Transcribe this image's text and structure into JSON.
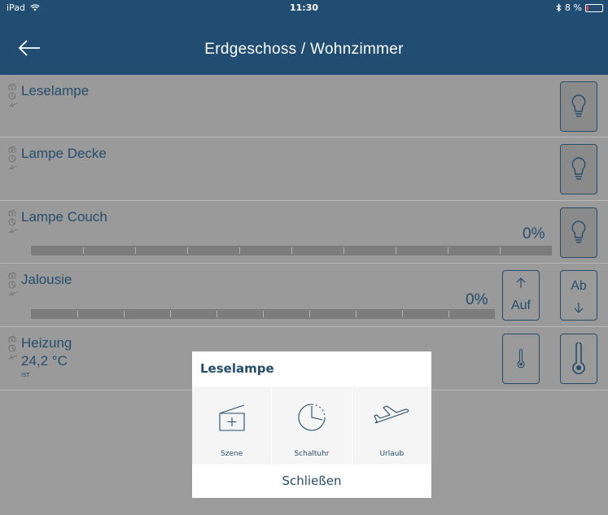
{
  "status_bar": {
    "device": "iPad",
    "time": "11:30",
    "battery_text": "8 %",
    "battery_level_fraction": 0.08
  },
  "nav": {
    "title": "Erdgeschoss / Wohnzimmer"
  },
  "rows": [
    {
      "name": "Leselampe"
    },
    {
      "name": "Lampe Decke"
    },
    {
      "name": "Lampe Couch",
      "percent": "0%",
      "level_fraction": 0.0
    },
    {
      "name": "Jalousie",
      "percent": "0%",
      "level_fraction": 0.0,
      "up_label": "Auf",
      "down_label": "Ab"
    },
    {
      "name": "Heizung",
      "value": "24,2 °C",
      "sub": "IST"
    }
  ],
  "modal": {
    "title": "Leselampe",
    "options": [
      {
        "label": "Szene",
        "icon": "scene-icon"
      },
      {
        "label": "Schaltuhr",
        "icon": "clock-icon"
      },
      {
        "label": "Urlaub",
        "icon": "plane-icon"
      }
    ],
    "close_label": "Schließen"
  },
  "colors": {
    "header": "#214d72",
    "text": "#244d6b",
    "overlay": "#9b9b9b",
    "battery_low": "#ff3b30"
  }
}
